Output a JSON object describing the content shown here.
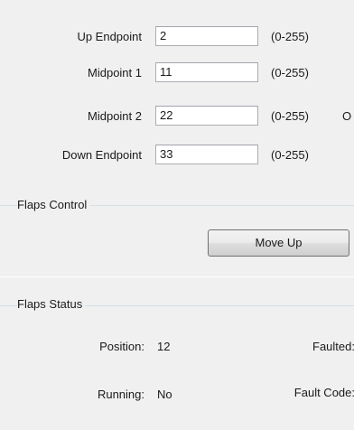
{
  "endpoints": {
    "rows": [
      {
        "label": "Up Endpoint",
        "value": "2",
        "range": "(0-255)",
        "trailing": ""
      },
      {
        "label": "Midpoint 1",
        "value": "11",
        "range": "(0-255)",
        "trailing": ""
      },
      {
        "label": "Midpoint 2",
        "value": "22",
        "range": "(0-255)",
        "trailing": "O"
      },
      {
        "label": "Down Endpoint",
        "value": "33",
        "range": "(0-255)",
        "trailing": ""
      }
    ]
  },
  "flaps_control": {
    "title": "Flaps Control",
    "move_up_label": "Move Up"
  },
  "flaps_status": {
    "title": "Flaps Status",
    "position_label": "Position:",
    "position_value": "12",
    "running_label": "Running:",
    "running_value": "No",
    "faulted_label": "Faulted:",
    "fault_code_label": "Fault Code:"
  }
}
